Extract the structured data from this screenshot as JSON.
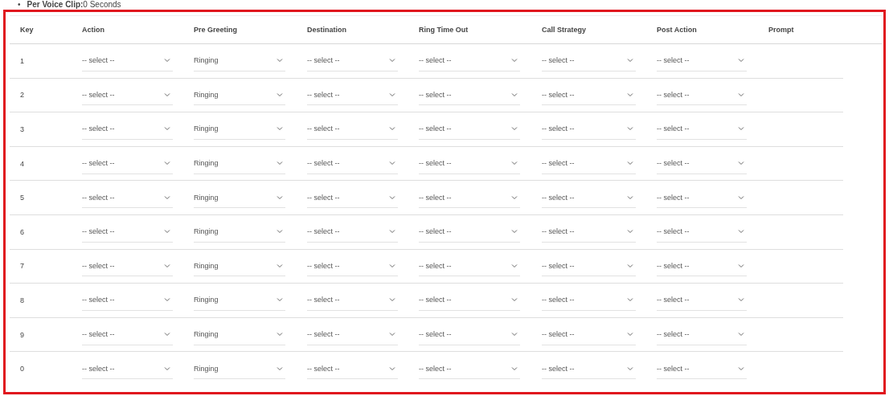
{
  "note": {
    "bullet": "•",
    "text": "**Per Voice Clip:**0 Seconds"
  },
  "table": {
    "columns": [
      "Key",
      "Action",
      "Pre Greeting",
      "Destination",
      "Ring Time Out",
      "Call Strategy",
      "Post Action",
      "Prompt"
    ],
    "rows": [
      {
        "key": "1",
        "selects": [
          "-- select --",
          "Ringing",
          "-- select --",
          "-- select --",
          "-- select --",
          "-- select --"
        ]
      },
      {
        "key": "2",
        "selects": [
          "-- select --",
          "Ringing",
          "-- select --",
          "-- select --",
          "-- select --",
          "-- select --"
        ]
      },
      {
        "key": "3",
        "selects": [
          "-- select --",
          "Ringing",
          "-- select --",
          "-- select --",
          "-- select --",
          "-- select --"
        ]
      },
      {
        "key": "4",
        "selects": [
          "-- select --",
          "Ringing",
          "-- select --",
          "-- select --",
          "-- select --",
          "-- select --"
        ]
      },
      {
        "key": "5",
        "selects": [
          "-- select --",
          "Ringing",
          "-- select --",
          "-- select --",
          "-- select --",
          "-- select --"
        ]
      },
      {
        "key": "6",
        "selects": [
          "-- select --",
          "Ringing",
          "-- select --",
          "-- select --",
          "-- select --",
          "-- select --"
        ]
      },
      {
        "key": "7",
        "selects": [
          "-- select --",
          "Ringing",
          "-- select --",
          "-- select --",
          "-- select --",
          "-- select --"
        ]
      },
      {
        "key": "8",
        "selects": [
          "-- select --",
          "Ringing",
          "-- select --",
          "-- select --",
          "-- select --",
          "-- select --"
        ]
      },
      {
        "key": "9",
        "selects": [
          "-- select --",
          "Ringing",
          "-- select --",
          "-- select --",
          "-- select --",
          "-- select --"
        ]
      },
      {
        "key": "0",
        "selects": [
          "-- select --",
          "Ringing",
          "-- select --",
          "-- select --",
          "-- select --",
          "-- select --"
        ]
      }
    ]
  }
}
